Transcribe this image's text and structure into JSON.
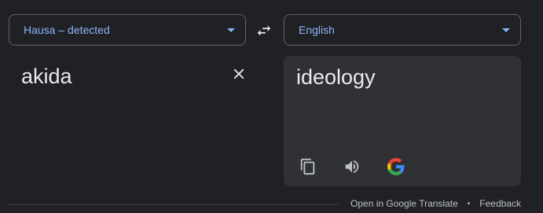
{
  "source_language": {
    "label": "Hausa – detected"
  },
  "target_language": {
    "label": "English"
  },
  "source": {
    "text": "akida"
  },
  "result": {
    "text": "ideology"
  },
  "footer": {
    "open_link": "Open in Google Translate",
    "separator": "•",
    "feedback": "Feedback"
  },
  "icons": {
    "swap": "swap-icon",
    "clear": "close-icon",
    "copy": "copy-icon",
    "listen": "speaker-icon",
    "google": "google-logo-icon",
    "dropdown": "chevron-down-icon"
  },
  "colors": {
    "background": "#202124",
    "panel": "#303134",
    "accent": "#8ab4f8",
    "text": "#e8eaed",
    "muted": "#bdc1c6",
    "border": "#5f6368"
  }
}
